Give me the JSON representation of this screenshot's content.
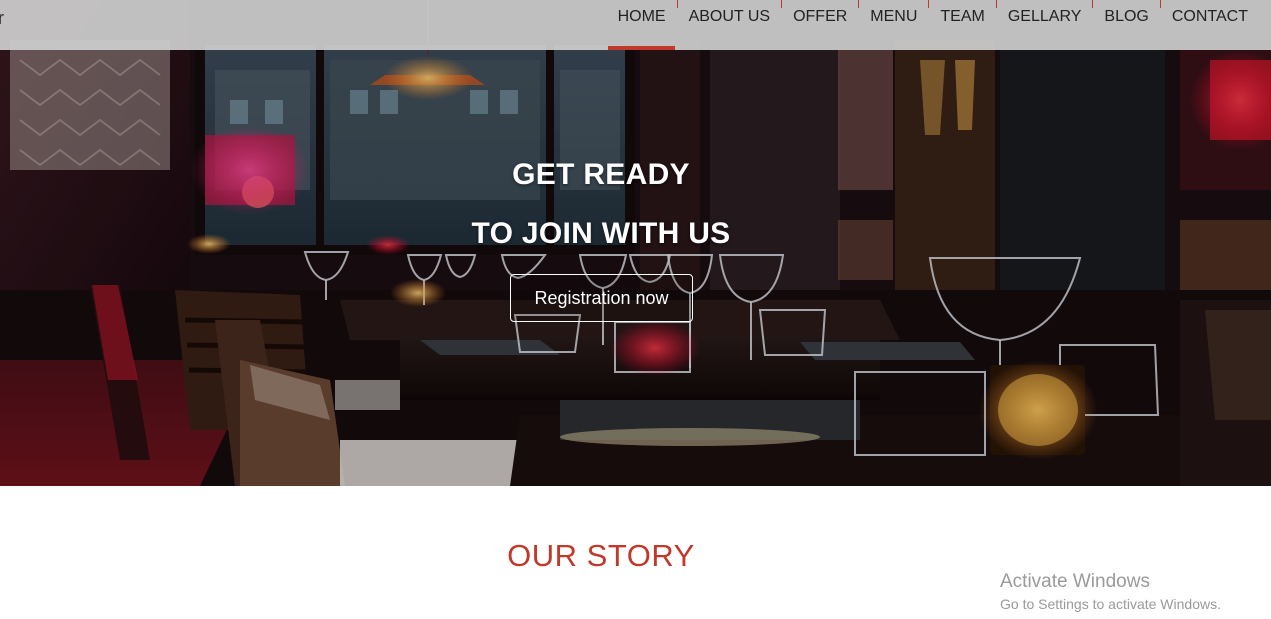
{
  "brand": {
    "fragment": "r"
  },
  "nav": {
    "items": [
      {
        "label": "HOME",
        "active": true
      },
      {
        "label": "ABOUT US",
        "active": false
      },
      {
        "label": "OFFER",
        "active": false
      },
      {
        "label": "MENU",
        "active": false
      },
      {
        "label": "TEAM",
        "active": false
      },
      {
        "label": "GELLARY",
        "active": false
      },
      {
        "label": "BLOG",
        "active": false
      },
      {
        "label": "CONTACT",
        "active": false
      }
    ]
  },
  "hero": {
    "line1": "GET READY",
    "line2": "TO JOIN WITH US",
    "button_label": "Registration now"
  },
  "story": {
    "title": "OUR STORY"
  },
  "watermark": {
    "title": "Activate Windows",
    "subtitle": "Go to Settings to activate Windows."
  },
  "colors": {
    "accent": "#c0392b",
    "nav_background": "#cdcdcd",
    "hero_text": "#ffffff"
  }
}
